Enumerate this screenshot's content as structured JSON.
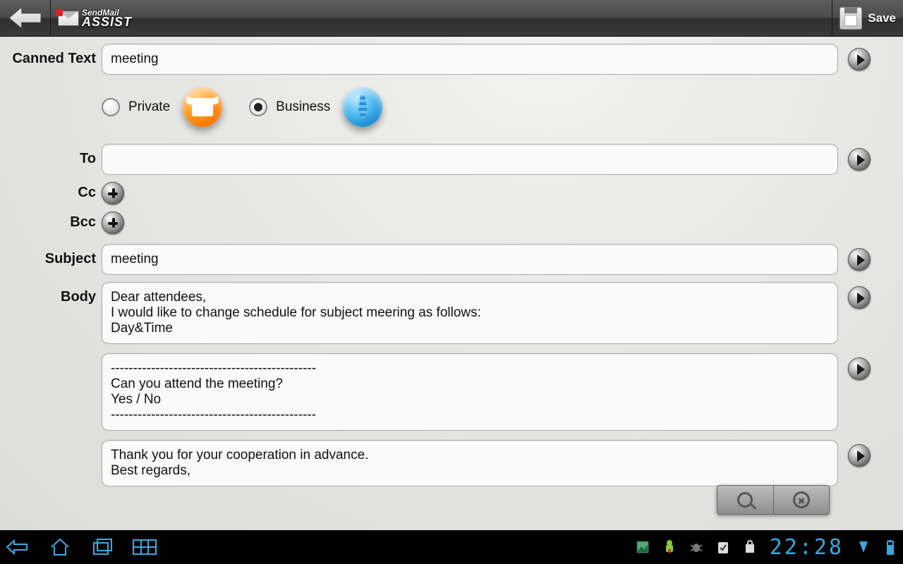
{
  "header": {
    "app_brand_line1": "SendMail",
    "app_brand_line2": "ASSIST",
    "save_label": "Save"
  },
  "form": {
    "canned_text_label": "Canned Text",
    "canned_text_value": "meeting",
    "category": {
      "private_label": "Private",
      "business_label": "Business",
      "selected": "business"
    },
    "to_label": "To",
    "to_value": "",
    "cc_label": "Cc",
    "bcc_label": "Bcc",
    "subject_label": "Subject",
    "subject_value": "meeting",
    "body_label": "Body",
    "body_block1": "Dear attendees,\nI would like to change schedule for subject meering as follows:\nDay&Time",
    "body_block2": "----------------------------------------------\nCan you attend the meeting?\nYes / No\n----------------------------------------------",
    "body_block3": "Thank you for your cooperation in advance.\nBest regards,"
  },
  "status": {
    "clock": "22:28"
  }
}
